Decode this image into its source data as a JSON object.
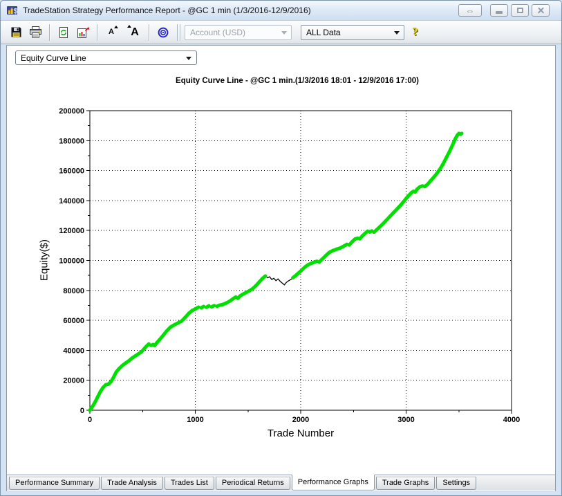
{
  "window": {
    "title": "TradeStation Strategy Performance Report - @GC 1 min (1/3/2016-12/9/2016)",
    "controls": {
      "resize_glyph": "⇔"
    }
  },
  "toolbar": {
    "font_smaller": "A",
    "font_larger": "A",
    "help_glyph": "?",
    "account_combo": {
      "value": "Account (USD)",
      "disabled": true
    },
    "data_combo": {
      "value": "ALL Data"
    }
  },
  "graph_selector": {
    "value": "Equity Curve Line"
  },
  "chart_data": {
    "type": "line",
    "title": "Equity Curve Line - @GC 1 min.(1/3/2016 18:01 - 12/9/2016 17:00)",
    "xlabel": "Trade Number",
    "ylabel": "Equity($)",
    "xlim": [
      0,
      4000
    ],
    "ylim": [
      0,
      200000
    ],
    "x_major_step": 1000,
    "x_minor_step": 500,
    "y_major_step": 20000,
    "y_minor_step": 10000,
    "grid": "dotted-at-major-ticks",
    "legend": "none",
    "series": [
      {
        "name": "Equity",
        "new_high_color": "#00e000",
        "drawdown_color": "#000000",
        "new_high_tolerance": 400,
        "points": [
          [
            0,
            0
          ],
          [
            25,
            2500
          ],
          [
            50,
            5500
          ],
          [
            75,
            9000
          ],
          [
            100,
            12500
          ],
          [
            125,
            15200
          ],
          [
            150,
            17000
          ],
          [
            175,
            17400
          ],
          [
            200,
            19000
          ],
          [
            225,
            22000
          ],
          [
            250,
            25500
          ],
          [
            280,
            28000
          ],
          [
            310,
            30000
          ],
          [
            340,
            31500
          ],
          [
            370,
            33000
          ],
          [
            400,
            34800
          ],
          [
            430,
            36200
          ],
          [
            460,
            37600
          ],
          [
            490,
            39000
          ],
          [
            515,
            41000
          ],
          [
            540,
            43000
          ],
          [
            560,
            44300
          ],
          [
            580,
            43300
          ],
          [
            600,
            43900
          ],
          [
            615,
            43100
          ],
          [
            630,
            44600
          ],
          [
            660,
            47000
          ],
          [
            695,
            50000
          ],
          [
            730,
            53000
          ],
          [
            765,
            55500
          ],
          [
            800,
            57000
          ],
          [
            835,
            58200
          ],
          [
            870,
            59500
          ],
          [
            905,
            62000
          ],
          [
            940,
            64800
          ],
          [
            970,
            66500
          ],
          [
            1000,
            67600
          ],
          [
            1030,
            68800
          ],
          [
            1055,
            68300
          ],
          [
            1080,
            69300
          ],
          [
            1105,
            68700
          ],
          [
            1130,
            69700
          ],
          [
            1155,
            69000
          ],
          [
            1180,
            69900
          ],
          [
            1205,
            69400
          ],
          [
            1230,
            70100
          ],
          [
            1260,
            70600
          ],
          [
            1295,
            71600
          ],
          [
            1330,
            73000
          ],
          [
            1365,
            74800
          ],
          [
            1385,
            75600
          ],
          [
            1405,
            74700
          ],
          [
            1425,
            76300
          ],
          [
            1455,
            77600
          ],
          [
            1485,
            78700
          ],
          [
            1515,
            79800
          ],
          [
            1545,
            81200
          ],
          [
            1575,
            83200
          ],
          [
            1605,
            85500
          ],
          [
            1635,
            87800
          ],
          [
            1665,
            89600
          ],
          [
            1685,
            88400
          ],
          [
            1705,
            89100
          ],
          [
            1725,
            87300
          ],
          [
            1745,
            88100
          ],
          [
            1765,
            86500
          ],
          [
            1785,
            87700
          ],
          [
            1805,
            86100
          ],
          [
            1825,
            84900
          ],
          [
            1845,
            83700
          ],
          [
            1865,
            85400
          ],
          [
            1885,
            86400
          ],
          [
            1905,
            87200
          ],
          [
            1925,
            88400
          ],
          [
            1950,
            89800
          ],
          [
            1980,
            91600
          ],
          [
            2010,
            93600
          ],
          [
            2040,
            95600
          ],
          [
            2070,
            97100
          ],
          [
            2100,
            98100
          ],
          [
            2130,
            98900
          ],
          [
            2155,
            99500
          ],
          [
            2175,
            98900
          ],
          [
            2200,
            100600
          ],
          [
            2235,
            103000
          ],
          [
            2270,
            105300
          ],
          [
            2305,
            106600
          ],
          [
            2340,
            107500
          ],
          [
            2375,
            108300
          ],
          [
            2410,
            109600
          ],
          [
            2440,
            110800
          ],
          [
            2460,
            110300
          ],
          [
            2485,
            112300
          ],
          [
            2515,
            114300
          ],
          [
            2540,
            114900
          ],
          [
            2560,
            114400
          ],
          [
            2585,
            116400
          ],
          [
            2610,
            118000
          ],
          [
            2635,
            119600
          ],
          [
            2655,
            119000
          ],
          [
            2675,
            119700
          ],
          [
            2695,
            118900
          ],
          [
            2715,
            120100
          ],
          [
            2745,
            122100
          ],
          [
            2780,
            124500
          ],
          [
            2815,
            127000
          ],
          [
            2850,
            129700
          ],
          [
            2885,
            132300
          ],
          [
            2920,
            134800
          ],
          [
            2955,
            137500
          ],
          [
            2990,
            140500
          ],
          [
            3020,
            143000
          ],
          [
            3050,
            145200
          ],
          [
            3070,
            146200
          ],
          [
            3085,
            145700
          ],
          [
            3105,
            147600
          ],
          [
            3130,
            149100
          ],
          [
            3155,
            149800
          ],
          [
            3175,
            149300
          ],
          [
            3200,
            150600
          ],
          [
            3230,
            153000
          ],
          [
            3260,
            155400
          ],
          [
            3290,
            157900
          ],
          [
            3320,
            160900
          ],
          [
            3350,
            164400
          ],
          [
            3380,
            168400
          ],
          [
            3410,
            172500
          ],
          [
            3440,
            177000
          ],
          [
            3465,
            181000
          ],
          [
            3485,
            183600
          ],
          [
            3500,
            184800
          ],
          [
            3515,
            184200
          ],
          [
            3528,
            184800
          ]
        ]
      }
    ]
  },
  "tabs": [
    {
      "label": "Performance Summary",
      "active": false
    },
    {
      "label": "Trade Analysis",
      "active": false
    },
    {
      "label": "Trades List",
      "active": false
    },
    {
      "label": "Periodical Returns",
      "active": false
    },
    {
      "label": "Performance Graphs",
      "active": true
    },
    {
      "label": "Trade Graphs",
      "active": false
    },
    {
      "label": "Settings",
      "active": false
    }
  ],
  "colors": {
    "equity_new_high": "#00e000",
    "equity_drawdown": "#000000",
    "window_frame": "#d4e3f4",
    "titlebar_gradient_top": "#f3f8fd",
    "titlebar_gradient_bottom": "#cfdff1",
    "help_yellow": "#f0da00",
    "target_blue": "#2424cc"
  }
}
